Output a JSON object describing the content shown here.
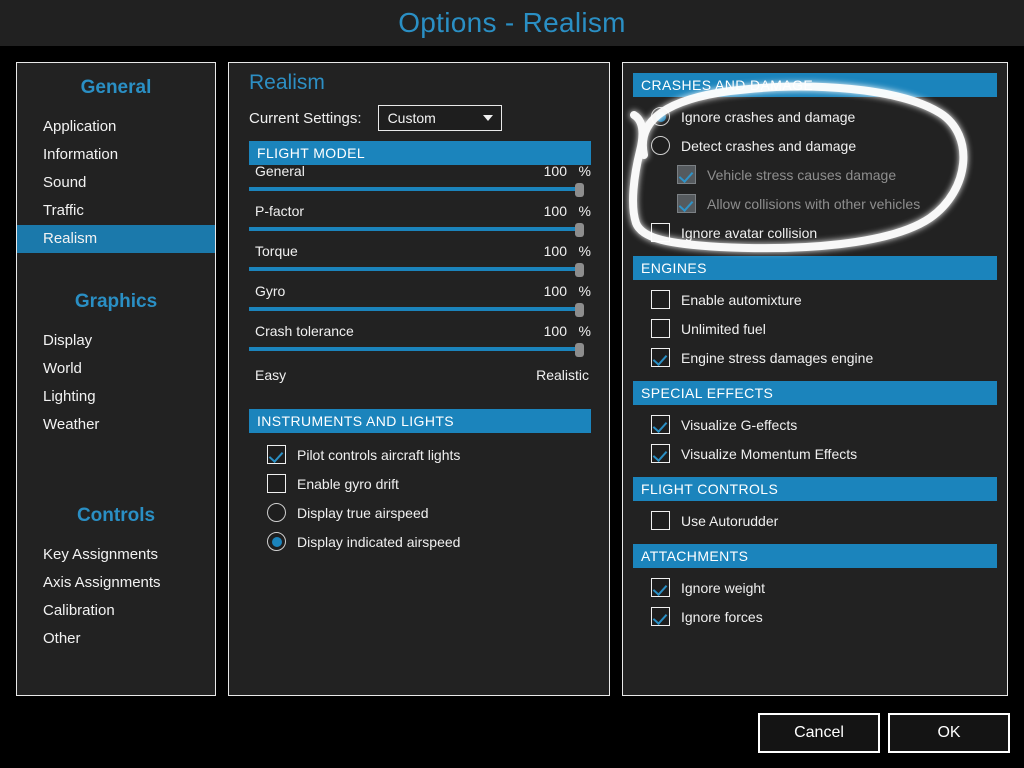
{
  "window": {
    "title": "Options - Realism"
  },
  "sidebar": {
    "groups": [
      {
        "heading": "General",
        "items": [
          {
            "label": "Application",
            "selected": false
          },
          {
            "label": "Information",
            "selected": false
          },
          {
            "label": "Sound",
            "selected": false
          },
          {
            "label": "Traffic",
            "selected": false
          },
          {
            "label": "Realism",
            "selected": true
          }
        ]
      },
      {
        "heading": "Graphics",
        "items": [
          {
            "label": "Display",
            "selected": false
          },
          {
            "label": "World",
            "selected": false
          },
          {
            "label": "Lighting",
            "selected": false
          },
          {
            "label": "Weather",
            "selected": false
          }
        ]
      },
      {
        "heading": "Controls",
        "items": [
          {
            "label": "Key Assignments",
            "selected": false
          },
          {
            "label": "Axis Assignments",
            "selected": false
          },
          {
            "label": "Calibration",
            "selected": false
          },
          {
            "label": "Other",
            "selected": false
          }
        ]
      }
    ]
  },
  "middle": {
    "pane_title": "Realism",
    "current_settings_label": "Current Settings:",
    "current_settings_value": "Custom",
    "current_settings_options": [
      "Custom"
    ],
    "flight_model": {
      "header": "FLIGHT MODEL",
      "sliders": [
        {
          "name": "General",
          "value": 100,
          "unit": "%"
        },
        {
          "name": "P-factor",
          "value": 100,
          "unit": "%"
        },
        {
          "name": "Torque",
          "value": 100,
          "unit": "%"
        },
        {
          "name": "Gyro",
          "value": 100,
          "unit": "%"
        },
        {
          "name": "Crash tolerance",
          "value": 100,
          "unit": "%"
        }
      ],
      "scale_min_label": "Easy",
      "scale_max_label": "Realistic"
    },
    "instruments": {
      "header": "INSTRUMENTS AND LIGHTS",
      "options": [
        {
          "type": "checkbox",
          "label": "Pilot controls aircraft lights",
          "checked": true,
          "disabled": false
        },
        {
          "type": "checkbox",
          "label": "Enable gyro drift",
          "checked": false,
          "disabled": false
        },
        {
          "type": "radio",
          "label": "Display true airspeed",
          "checked": false,
          "disabled": false
        },
        {
          "type": "radio",
          "label": "Display indicated airspeed",
          "checked": true,
          "disabled": false
        }
      ]
    }
  },
  "right": {
    "sections": [
      {
        "header": "CRASHES AND DAMAGE",
        "options": [
          {
            "type": "radio",
            "label": "Ignore crashes and damage",
            "checked": true,
            "disabled": false,
            "indent": 0
          },
          {
            "type": "radio",
            "label": "Detect crashes and damage",
            "checked": false,
            "disabled": false,
            "indent": 0
          },
          {
            "type": "checkbox",
            "label": "Vehicle stress causes damage",
            "checked": true,
            "disabled": true,
            "indent": 1
          },
          {
            "type": "checkbox",
            "label": "Allow collisions with other vehicles",
            "checked": true,
            "disabled": true,
            "indent": 1
          },
          {
            "type": "checkbox",
            "label": "Ignore avatar collision",
            "checked": false,
            "disabled": false,
            "indent": 0
          }
        ]
      },
      {
        "header": "ENGINES",
        "options": [
          {
            "type": "checkbox",
            "label": "Enable automixture",
            "checked": false,
            "disabled": false,
            "indent": 0
          },
          {
            "type": "checkbox",
            "label": "Unlimited fuel",
            "checked": false,
            "disabled": false,
            "indent": 0
          },
          {
            "type": "checkbox",
            "label": "Engine stress damages engine",
            "checked": true,
            "disabled": false,
            "indent": 0
          }
        ]
      },
      {
        "header": "SPECIAL EFFECTS",
        "options": [
          {
            "type": "checkbox",
            "label": "Visualize G-effects",
            "checked": true,
            "disabled": false,
            "indent": 0
          },
          {
            "type": "checkbox",
            "label": "Visualize Momentum Effects",
            "checked": true,
            "disabled": false,
            "indent": 0
          }
        ]
      },
      {
        "header": "FLIGHT CONTROLS",
        "options": [
          {
            "type": "checkbox",
            "label": "Use Autorudder",
            "checked": false,
            "disabled": false,
            "indent": 0
          }
        ]
      },
      {
        "header": "ATTACHMENTS",
        "options": [
          {
            "type": "checkbox",
            "label": "Ignore weight",
            "checked": true,
            "disabled": false,
            "indent": 0
          },
          {
            "type": "checkbox",
            "label": "Ignore forces",
            "checked": true,
            "disabled": false,
            "indent": 0
          }
        ]
      }
    ]
  },
  "footer": {
    "cancel_label": "Cancel",
    "ok_label": "OK"
  },
  "annotation": {
    "shape": "hand-drawn-circle",
    "color": "#ffffff",
    "targets": "CRASHES AND DAMAGE section"
  },
  "colors": {
    "accent": "#1b84bc",
    "title": "#2a8fc4",
    "panel_bg": "#222222",
    "page_bg": "#000000",
    "text": "#f0f0f0",
    "disabled_text": "#8e8e8e"
  }
}
